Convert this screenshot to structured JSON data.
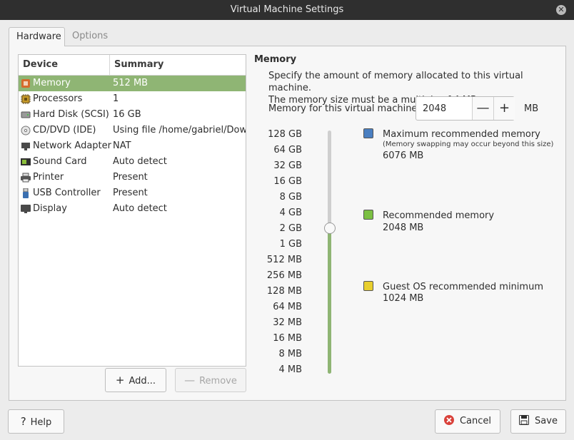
{
  "window": {
    "title": "Virtual Machine Settings",
    "close_glyph": "✕"
  },
  "tabs": [
    {
      "label": "Hardware"
    },
    {
      "label": "Options"
    }
  ],
  "device_list": {
    "headers": {
      "device": "Device",
      "summary": "Summary"
    },
    "rows": [
      {
        "device": "Memory",
        "summary": "512 MB",
        "icon": "memory-icon"
      },
      {
        "device": "Processors",
        "summary": "1",
        "icon": "processor-icon"
      },
      {
        "device": "Hard Disk (SCSI)",
        "summary": "16 GB",
        "icon": "hard-disk-icon"
      },
      {
        "device": "CD/DVD (IDE)",
        "summary": "Using file /home/gabriel/Down",
        "icon": "cd-dvd-icon"
      },
      {
        "device": "Network Adapter",
        "summary": "NAT",
        "icon": "network-icon"
      },
      {
        "device": "Sound Card",
        "summary": "Auto detect",
        "icon": "sound-card-icon"
      },
      {
        "device": "Printer",
        "summary": "Present",
        "icon": "printer-icon"
      },
      {
        "device": "USB Controller",
        "summary": "Present",
        "icon": "usb-icon"
      },
      {
        "device": "Display",
        "summary": "Auto detect",
        "icon": "display-icon"
      }
    ],
    "selected_index": 0
  },
  "list_buttons": {
    "add": "Add...",
    "remove": "Remove",
    "add_glyph": "+",
    "remove_glyph": "—"
  },
  "memory": {
    "title": "Memory",
    "description_1": "Specify the amount of memory allocated to this virtual machine.",
    "description_2": "The memory size must be a multiple of 4 MB.",
    "field_label": "Memory for this virtual machine:",
    "value": "2048",
    "minus": "—",
    "plus": "+",
    "unit": "MB",
    "scale": [
      "128 GB",
      "64 GB",
      "32 GB",
      "16 GB",
      "8 GB",
      "4 GB",
      "2 GB",
      "1 GB",
      "512 MB",
      "256 MB",
      "128 MB",
      "64 MB",
      "32 MB",
      "16 MB",
      "8 MB",
      "4 MB"
    ],
    "slider_position_label": "2 GB",
    "recommendations": {
      "max": {
        "title": "Maximum recommended memory",
        "note": "(Memory swapping may occur beyond this size)",
        "value": "6076 MB",
        "color": "#4a7fc1"
      },
      "recommended": {
        "title": "Recommended memory",
        "value": "2048 MB",
        "color": "#7bc043"
      },
      "minimum": {
        "title": "Guest OS recommended minimum",
        "value": "1024 MB",
        "color": "#e8cf2e"
      }
    }
  },
  "footer": {
    "help": "Help",
    "help_glyph": "?",
    "cancel": "Cancel",
    "save": "Save"
  },
  "colors": {
    "selection": "#8fb574",
    "cancel_icon": "#d9413a"
  }
}
